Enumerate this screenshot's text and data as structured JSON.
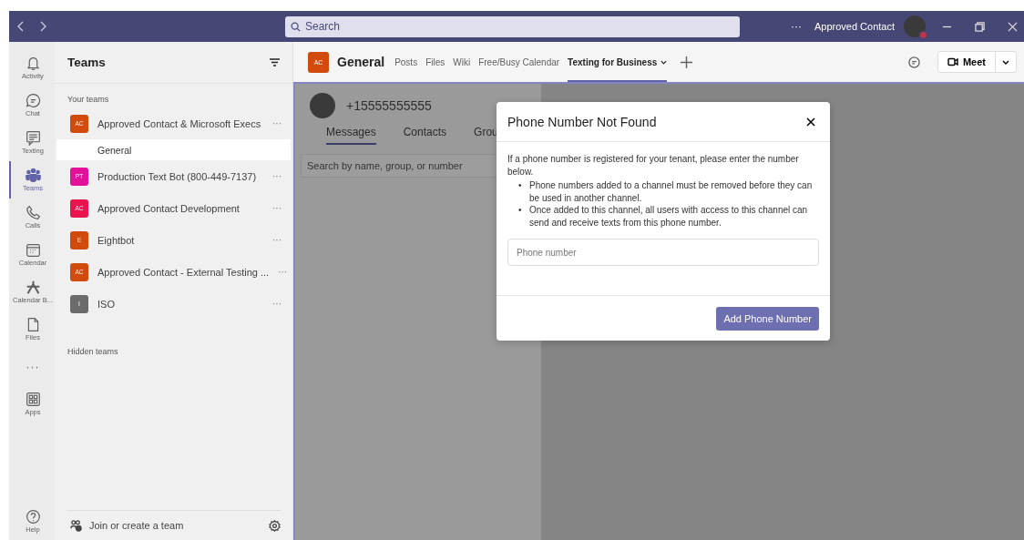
{
  "title_bar": {
    "search": {
      "placeholder": "Search"
    },
    "more": "···",
    "user_name": "Approved Contact"
  },
  "app_bar": {
    "items": [
      {
        "kind": "app",
        "label": "Activity",
        "selected": false
      },
      {
        "kind": "app",
        "label": "Chat",
        "selected": false
      },
      {
        "kind": "app",
        "label": "Texting",
        "selected": false
      },
      {
        "kind": "app",
        "label": "Teams",
        "selected": true
      },
      {
        "kind": "app",
        "label": "Calls",
        "selected": false
      },
      {
        "kind": "app",
        "label": "Calendar",
        "selected": false
      },
      {
        "kind": "app",
        "label": "Calendar B...",
        "selected": false
      },
      {
        "kind": "app",
        "label": "Files",
        "selected": false
      },
      {
        "kind": "more",
        "label": "···",
        "selected": false
      },
      {
        "kind": "app",
        "label": "Apps",
        "selected": false
      }
    ],
    "help": "Help"
  },
  "teams_panel": {
    "title": "Teams",
    "section": "Your teams",
    "teams": [
      {
        "initials": "AC",
        "name": "Approved Contact & Microsoft Execs",
        "color": "#d24a0c",
        "more": "···",
        "children": [
          {
            "name": "General",
            "selected": true
          }
        ]
      },
      {
        "initials": "PT",
        "name": "Production Text Bot (800-449-7137)",
        "color": "#e3109a",
        "more": "···"
      },
      {
        "initials": "AC",
        "name": "Approved Contact Development",
        "color": "#e8134f",
        "more": "···"
      },
      {
        "initials": "E",
        "name": "Eightbot",
        "color": "#d24a0c",
        "more": "···"
      },
      {
        "initials": "AC",
        "name": "Approved Contact - External Testing ...",
        "color": "#d24a0c",
        "more": "···"
      },
      {
        "initials": "I",
        "name": "ISO",
        "color": "#6b6b6b",
        "more": "···"
      }
    ],
    "hidden_section": "Hidden teams",
    "footer": "Join or create a team"
  },
  "channel_header": {
    "initials": "AC",
    "name": "General",
    "tabs": [
      {
        "label": "Posts",
        "selected": false,
        "dropdown": false
      },
      {
        "label": "Files",
        "selected": false,
        "dropdown": false
      },
      {
        "label": "Wiki",
        "selected": false,
        "dropdown": false
      },
      {
        "label": "Free/Busy Calendar",
        "selected": false,
        "dropdown": false
      },
      {
        "label": "Texting for Business",
        "selected": true,
        "dropdown": true
      }
    ],
    "meet": "Meet"
  },
  "texting_app": {
    "phone": "+15555555555",
    "tabs": [
      {
        "label": "Messages",
        "selected": true
      },
      {
        "label": "Contacts",
        "selected": false
      },
      {
        "label": "Grou",
        "selected": false
      }
    ],
    "search": {
      "placeholder": "Search by name, group, or number"
    }
  },
  "dialog": {
    "title": "Phone Number Not Found",
    "intro": "If a phone number is registered for your tenant, please enter the number below.",
    "bullets": [
      {
        "marker": "•",
        "text": "Phone numbers added to a channel must be removed before they can be used in another channel."
      },
      {
        "marker": "•",
        "text": "Once added to this channel, all users with access to this channel can send and receive texts from this phone number."
      }
    ],
    "input": {
      "placeholder": "Phone number"
    },
    "button": "Add Phone Number"
  }
}
